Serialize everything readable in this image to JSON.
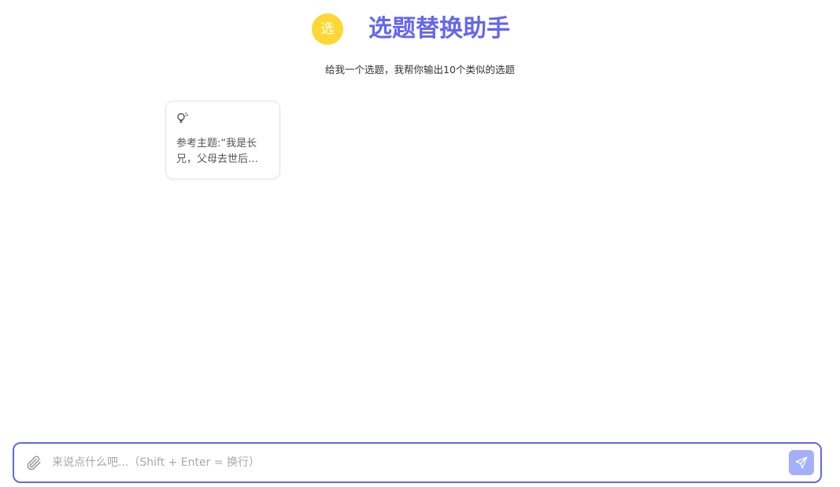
{
  "header": {
    "avatar_text": "选",
    "title": "选题替换助手"
  },
  "subtitle": "给我一个选题，我帮你输出10个类似的选题",
  "prompt_cards": [
    {
      "icon": "lightbulb-icon",
      "text": "参考主题:“我是长兄，父母去世后…"
    }
  ],
  "composer": {
    "attach_icon": "paperclip-icon",
    "placeholder": "来说点什么吧...（Shift + Enter = 换行）",
    "value": "",
    "send_icon": "send-icon"
  },
  "colors": {
    "accent": "#6366f1",
    "avatar_bg": "#fdd835",
    "send_button_bg": "#a5b0fc"
  }
}
